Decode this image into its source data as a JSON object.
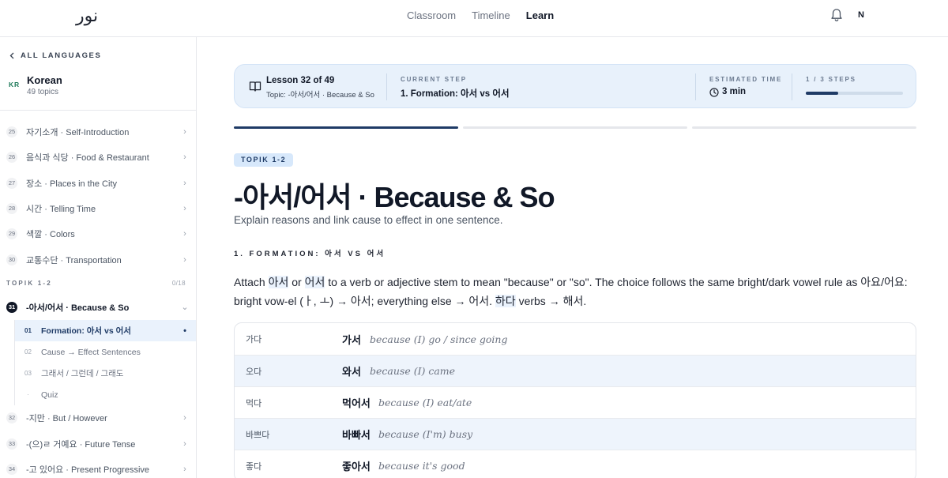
{
  "header": {
    "logo": "نور",
    "nav": [
      "Classroom",
      "Timeline",
      "Learn"
    ],
    "active_nav": "Learn",
    "avatar_initial": "N"
  },
  "sidebar": {
    "back_label": "ALL LANGUAGES",
    "language": {
      "code": "KR",
      "name": "Korean",
      "topics": "49 topics"
    },
    "topics_before": [
      {
        "num": "25",
        "label": "자기소개 · Self-Introduction"
      },
      {
        "num": "26",
        "label": "음식과 식당 · Food & Restaurant"
      },
      {
        "num": "27",
        "label": "장소 · Places in the City"
      },
      {
        "num": "28",
        "label": "시간 · Telling Time"
      },
      {
        "num": "29",
        "label": "색깔 · Colors"
      },
      {
        "num": "30",
        "label": "교통수단 · Transportation"
      }
    ],
    "group": {
      "label": "TOPIK 1-2",
      "count": "0/18"
    },
    "current_topic": {
      "num": "31",
      "label": "-아서/어서 · Because & So"
    },
    "subtopics": [
      {
        "num": "01",
        "label": "Formation: 아서 vs 어서"
      },
      {
        "num": "02",
        "label": "Cause → Effect Sentences"
      },
      {
        "num": "03",
        "label": "그래서 / 그런데 / 그래도"
      },
      {
        "num": "·",
        "label": "Quiz"
      }
    ],
    "topics_after": [
      {
        "num": "32",
        "label": "-지만 · But / However"
      },
      {
        "num": "33",
        "label": "-(으)ㄹ 거예요 · Future Tense"
      },
      {
        "num": "34",
        "label": "-고 있어요 · Present Progressive"
      }
    ]
  },
  "lesson_bar": {
    "lesson": "Lesson 32 of 49",
    "topic": "Topic: -아서/어서 · Because & So",
    "current_step_caption": "CURRENT STEP",
    "current_step": "1. Formation: 아서 vs 어서",
    "time_caption": "ESTIMATED TIME",
    "time": "3 min",
    "steps_caption": "1 / 3 STEPS",
    "steps_progress": 0.333
  },
  "content": {
    "badge": "TOPIK 1-2",
    "title": "-아서/어서 · Because & So",
    "subtitle": "Explain reasons and link cause to effect in one sentence.",
    "section": "1. FORMATION: 아서 VS 어서",
    "para": {
      "t1": "Attach ",
      "k1": "아서",
      "t2": " or ",
      "k2": "어서",
      "t3": " to a verb or adjective stem to mean \"because\" or \"so\". The choice follows the same bright/dark vowel rule as 아요/어요: bright vow-el (ㅏ, ㅗ) → 아서; everything else → 어서. ",
      "k3": "하다",
      "t4": " verbs → 해서."
    },
    "examples": [
      {
        "base": "가다",
        "form": "가서",
        "gloss": "because (I) go / since going"
      },
      {
        "base": "오다",
        "form": "와서",
        "gloss": "because (I) came"
      },
      {
        "base": "먹다",
        "form": "먹어서",
        "gloss": "because (I) eat/ate"
      },
      {
        "base": "바쁘다",
        "form": "바빠서",
        "gloss": "because (I'm) busy"
      },
      {
        "base": "좋다",
        "form": "좋아서",
        "gloss": "because it's good"
      }
    ]
  }
}
